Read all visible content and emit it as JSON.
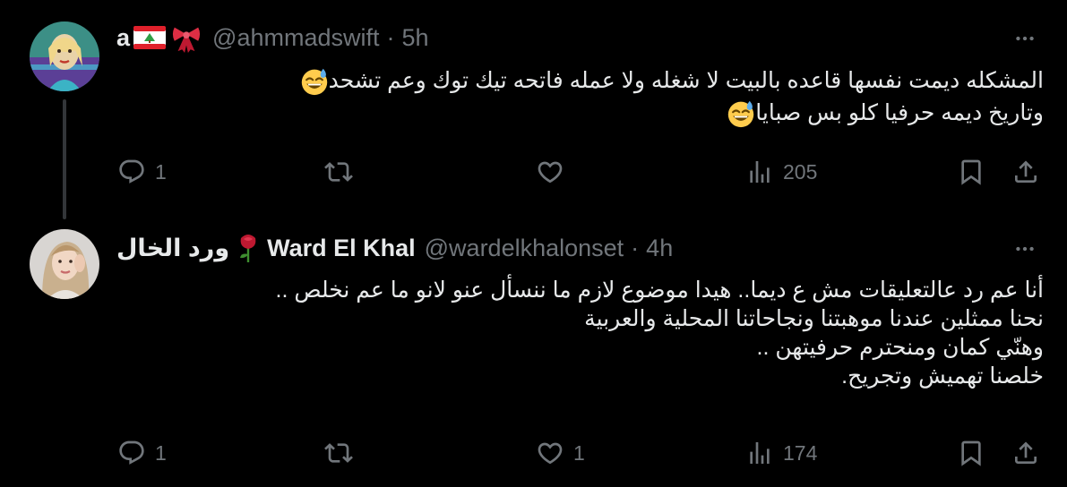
{
  "tweets": [
    {
      "name": "a",
      "handle": "@ahmmadswift",
      "time": "5h",
      "text_lines": [
        "المشكله ديمت نفسها قاعده بالبيت لا شغله ولا عمله فاتحه تيك توك وعم تشحد",
        "وتاريخ ديمه حرفيا كلو بس صبايا"
      ],
      "replies": "1",
      "reposts": "",
      "likes": "",
      "views": "205"
    },
    {
      "name_arabic": "ورد الخال",
      "name": "Ward El Khal",
      "handle": "@wardelkhalonset",
      "time": "4h",
      "text_lines": [
        "أنا عم رد عالتعليقات مش ع ديما.. هيدا موضوع لازم ما ننسأل عنو لانو ما عم نخلص ..",
        "نحنا ممثلين عندنا موهبتنا ونجاحاتنا المحلية والعربية",
        "وهنّي كمان ومنحترم حرفيتهن ..",
        "خلصنا تهميش وتجريح."
      ],
      "replies": "1",
      "reposts": "",
      "likes": "1",
      "views": "174"
    }
  ],
  "icons": [
    "reply-icon",
    "repost-icon",
    "like-icon",
    "views-icon",
    "bookmark-icon",
    "share-icon",
    "more-icon",
    "lebanon-flag-icon",
    "ribbon-icon",
    "rose-icon",
    "sweat-smile-emoji"
  ],
  "colors": {
    "background": "#000000",
    "text": "#e7e9ea",
    "muted": "#71767b",
    "thread": "#333639"
  }
}
